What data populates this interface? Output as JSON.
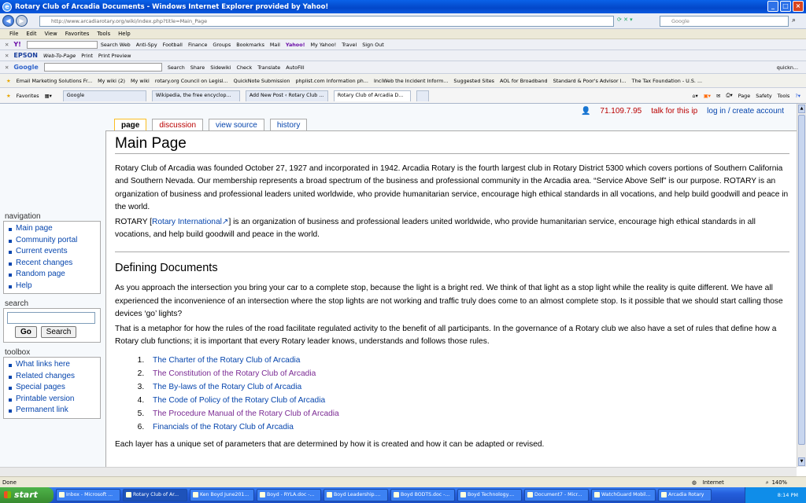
{
  "window": {
    "title": "Rotary Club of Arcadia Documents - Windows Internet Explorer provided by Yahoo!"
  },
  "address": {
    "url": "http://www.arcadiarotary.org/wiki/index.php?title=Main_Page",
    "search_placeholder": "Google"
  },
  "menu": [
    "File",
    "Edit",
    "View",
    "Favorites",
    "Tools",
    "Help"
  ],
  "toolbar1": [
    "Search Web",
    "Anti-Spy",
    "Football",
    "Finance",
    "Groups",
    "Bookmarks",
    "Mail",
    "Yahoo!",
    "My Yahoo!",
    "Travel",
    "Sign Out"
  ],
  "toolbar2": {
    "brand": "EPSON",
    "items": [
      "Web-To-Page",
      "Print",
      "Print Preview"
    ]
  },
  "toolbar3": {
    "brand": "Google",
    "items": [
      "Search",
      "Share",
      "Sidewiki",
      "Check",
      "Translate",
      "AutoFill"
    ],
    "right": "quickn..."
  },
  "links": [
    "Email Marketing Solutions Fr...",
    "My wiki (2)",
    "My wiki",
    "rotary.org Council on Legisl...",
    "QuickNote Submission",
    "phplist.com Information ph...",
    "InciWeb the Incident Inform...",
    "Suggested Sites",
    "AOL for Broadband",
    "Standard & Poor's Advisor I...",
    "The Tax Foundation - U.S. ..."
  ],
  "favorites_label": "Favorites",
  "tabs": [
    "Google",
    "Wikipedia, the free encyclop...",
    "Add New Post ‹ Rotary Club ...",
    "Rotary Club of Arcadia D..."
  ],
  "cmdbar": [
    "Page",
    "Safety",
    "Tools"
  ],
  "page_tabs": [
    "page",
    "discussion",
    "view source",
    "history"
  ],
  "personal": {
    "ip": "71.109.7.95",
    "talk": "talk for this ip",
    "login": "log in / create account"
  },
  "nav": {
    "title": "navigation",
    "items": [
      "Main page",
      "Community portal",
      "Current events",
      "Recent changes",
      "Random page",
      "Help"
    ]
  },
  "search": {
    "title": "search",
    "go": "Go",
    "search": "Search"
  },
  "toolbox": {
    "title": "toolbox",
    "items": [
      "What links here",
      "Related changes",
      "Special pages",
      "Printable version",
      "Permanent link"
    ]
  },
  "article": {
    "title": "Main Page",
    "p1": "Rotary Club of Arcadia was founded October 27, 1927 and incorporated in 1942. Arcadia Rotary is the fourth largest club in Rotary District 5300 which covers portions of Southern California and Southern Nevada. Our membership represents a broad spectrum of the business and professional community in the Arcadia area. “Service Above Self” is our purpose. ROTARY is an organization of business and professional leaders united worldwide, who provide humanitarian service, encourage high ethical standards in all vocations, and help build goodwill and peace in the world.",
    "p2_pre": "ROTARY [",
    "p2_link": "Rotary International",
    "p2_post": "] is an organization of business and professional leaders united worldwide, who provide humanitarian service, encourage high ethical standards in all vocations, and help build goodwill and peace in the world.",
    "h2": "Defining Documents",
    "p3": "As you approach the intersection you bring your car to a complete stop, because the light is a bright red. We think of that light as a stop light while the reality is quite different. We have all experienced the inconvenience of an intersection where the stop lights are not working and traffic truly does come to an almost complete stop. Is it possible that we should start calling those devices ‘go’ lights?",
    "p4": "That is a metaphor for how the rules of the road facilitate regulated activity to the benefit of all participants. In the governance of a Rotary club we also have a set of rules that define how a Rotary club functions; it is important that every Rotary leader knows, understands and follows those rules.",
    "list": [
      "The Charter of the Rotary Club of Arcadia",
      "The Constitution of the Rotary Club of Arcadia",
      "The By-laws of the Rotary Club of Arcadia",
      "The Code of Policy of the Rotary Club of Arcadia",
      "The Procedure Manual of the Rotary Club of Arcadia",
      "Financials of the Rotary Club of Arcadia"
    ],
    "p5": "Each layer has a unique set of parameters that are determined by how it is created and how it can be adapted or revised."
  },
  "status": {
    "left": "Done",
    "zone": "Internet",
    "zoom": "140%"
  },
  "taskbar": {
    "start": "start",
    "items": [
      "Inbox - Microsoft ...",
      "Rotary Club of Ar...",
      "Ken Boyd June201...",
      "Boyd - RYLA.doc -...",
      "Boyd Leadership....",
      "Boyd BODTS.doc -...",
      "Boyd Technology....",
      "Document7 - Micr...",
      "WatchGuard Mobil...",
      "Arcadia Rotary"
    ],
    "time": "8:14 PM"
  }
}
